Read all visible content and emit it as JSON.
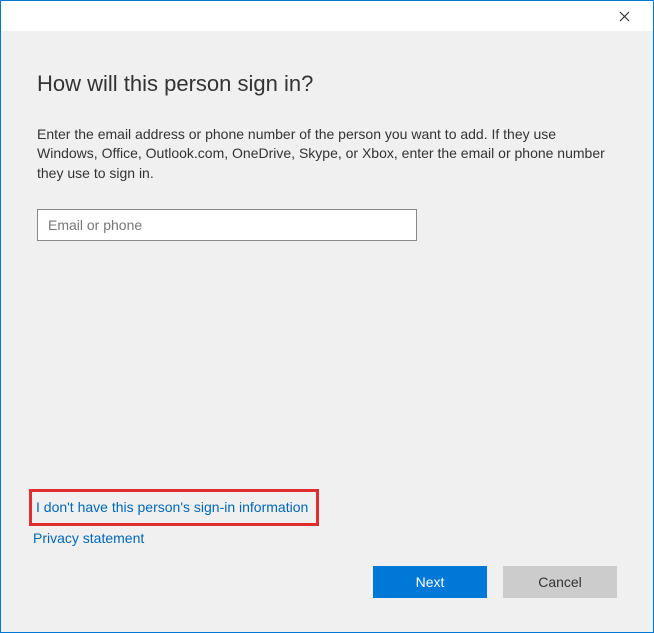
{
  "heading": "How will this person sign in?",
  "instruction": "Enter the email address or phone number of the person you want to add. If they use Windows, Office, Outlook.com, OneDrive, Skype, or Xbox, enter the email or phone number they use to sign in.",
  "input": {
    "placeholder": "Email or phone",
    "value": ""
  },
  "links": {
    "no_info": "I don't have this person's sign-in information",
    "privacy": "Privacy statement"
  },
  "buttons": {
    "next": "Next",
    "cancel": "Cancel"
  }
}
